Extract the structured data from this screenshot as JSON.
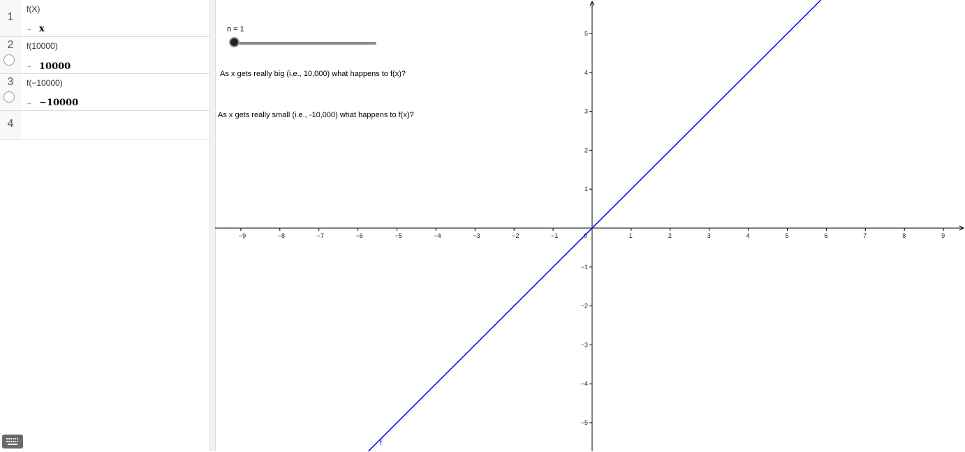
{
  "algebra": {
    "rows": [
      {
        "index": "1",
        "definition": "f(X)",
        "value": "x"
      },
      {
        "index": "2",
        "definition": "f(10000)",
        "value": "10000"
      },
      {
        "index": "3",
        "definition": "f(−10000)",
        "value": "−10000"
      },
      {
        "index": "4",
        "definition": "",
        "value": ""
      }
    ],
    "arrow_symbol": "→",
    "keyboard_icon": "keyboard-icon"
  },
  "graphics": {
    "slider": {
      "label": "n = 1",
      "value": 1
    },
    "question_big": "As x gets really big (i.e., 10,000) what happens to f(x)?",
    "question_small": "As x gets really small (i.e., -10,000) what happens to f(x)?",
    "function_label": "f",
    "line_color": "#0000ff",
    "x_ticks": [
      "−9",
      "−8",
      "−7",
      "−6",
      "−5",
      "−4",
      "−3",
      "−2",
      "−1",
      "0",
      "1",
      "2",
      "3",
      "4",
      "5",
      "6",
      "7",
      "8",
      "9"
    ],
    "y_ticks": [
      "5",
      "4",
      "3",
      "2",
      "1",
      "−1",
      "−2",
      "−3",
      "−4",
      "−5"
    ]
  }
}
